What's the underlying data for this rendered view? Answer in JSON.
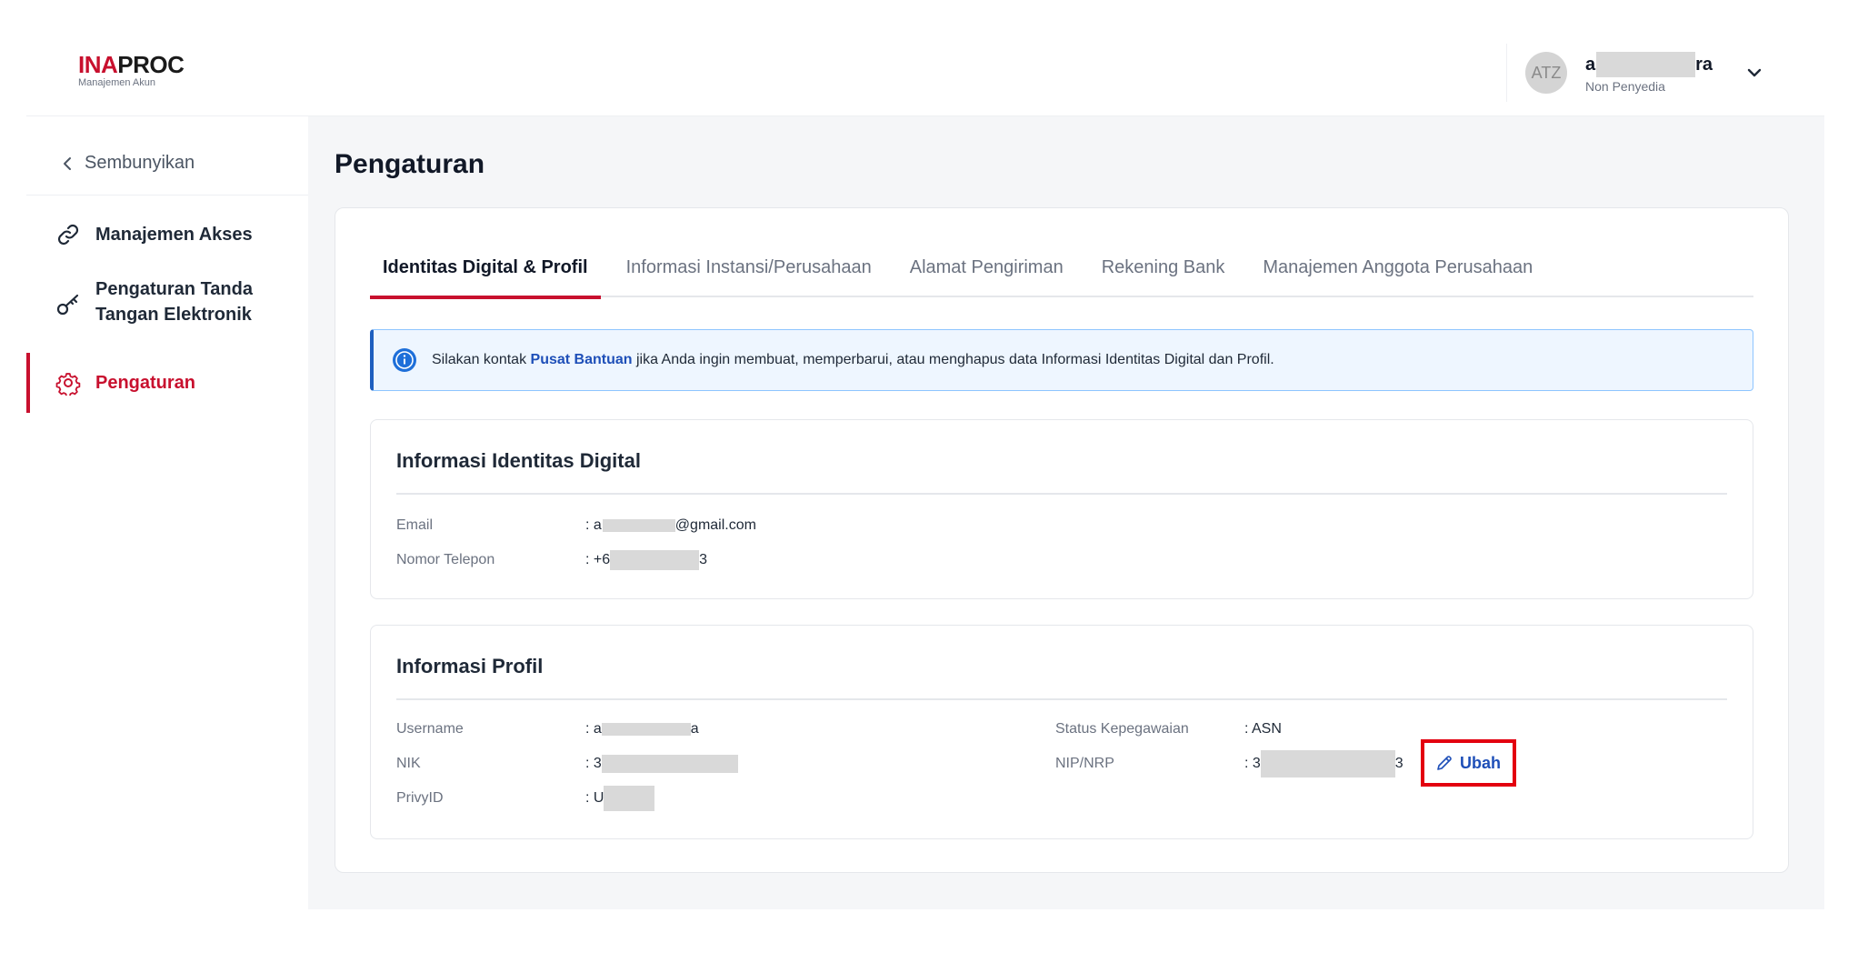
{
  "header": {
    "logo_ina": "INA",
    "logo_proc": "PROC",
    "logo_sub": "Manajemen Akun",
    "avatar_initials": "ATZ",
    "user_name_start": "a",
    "user_name_end": "ra",
    "user_role": "Non Penyedia",
    "menu_icon": "chevron-down-icon"
  },
  "sidebar": {
    "hide_label": "Sembunyikan",
    "items": [
      {
        "label": "Manajemen Akses",
        "icon": "link-icon"
      },
      {
        "label_line1": "Pengaturan Tanda",
        "label_line2": "Tangan Elektronik",
        "icon": "key-icon"
      },
      {
        "label": "Pengaturan",
        "icon": "gear-icon",
        "active": true
      }
    ]
  },
  "main": {
    "title": "Pengaturan",
    "tabs": [
      {
        "label": "Identitas Digital & Profil",
        "active": true
      },
      {
        "label": "Informasi Instansi/Perusahaan"
      },
      {
        "label": "Alamat Pengiriman"
      },
      {
        "label": "Rekening Bank"
      },
      {
        "label": "Manajemen Anggota Perusahaan"
      }
    ],
    "alert": {
      "before": "Silakan kontak ",
      "link": "Pusat Bantuan",
      "after": " jika Anda ingin membuat, memperbarui, atau menghapus data Informasi Identitas Digital dan Profil."
    },
    "digital_identity": {
      "title": "Informasi Identitas Digital",
      "email_label": "Email",
      "email_start": ": a",
      "email_end": "@gmail.com",
      "phone_label": "Nomor Telepon",
      "phone_start": ": +6",
      "phone_end": "3"
    },
    "profile": {
      "title": "Informasi Profil",
      "username_label": "Username",
      "username_start": ": a",
      "username_end": "a",
      "nik_label": "NIK",
      "nik_start": ": 3",
      "privy_label": "PrivyID",
      "privy_start": ": U",
      "status_label": "Status Kepegawaian",
      "status_value": ": ASN",
      "nip_label": "NIP/NRP",
      "nip_start": ": 3",
      "nip_end": "3",
      "edit_label": "Ubah"
    }
  },
  "colors": {
    "brand_red": "#c8102e",
    "link_blue": "#1e4fb8",
    "highlight_red": "#e3000f"
  }
}
